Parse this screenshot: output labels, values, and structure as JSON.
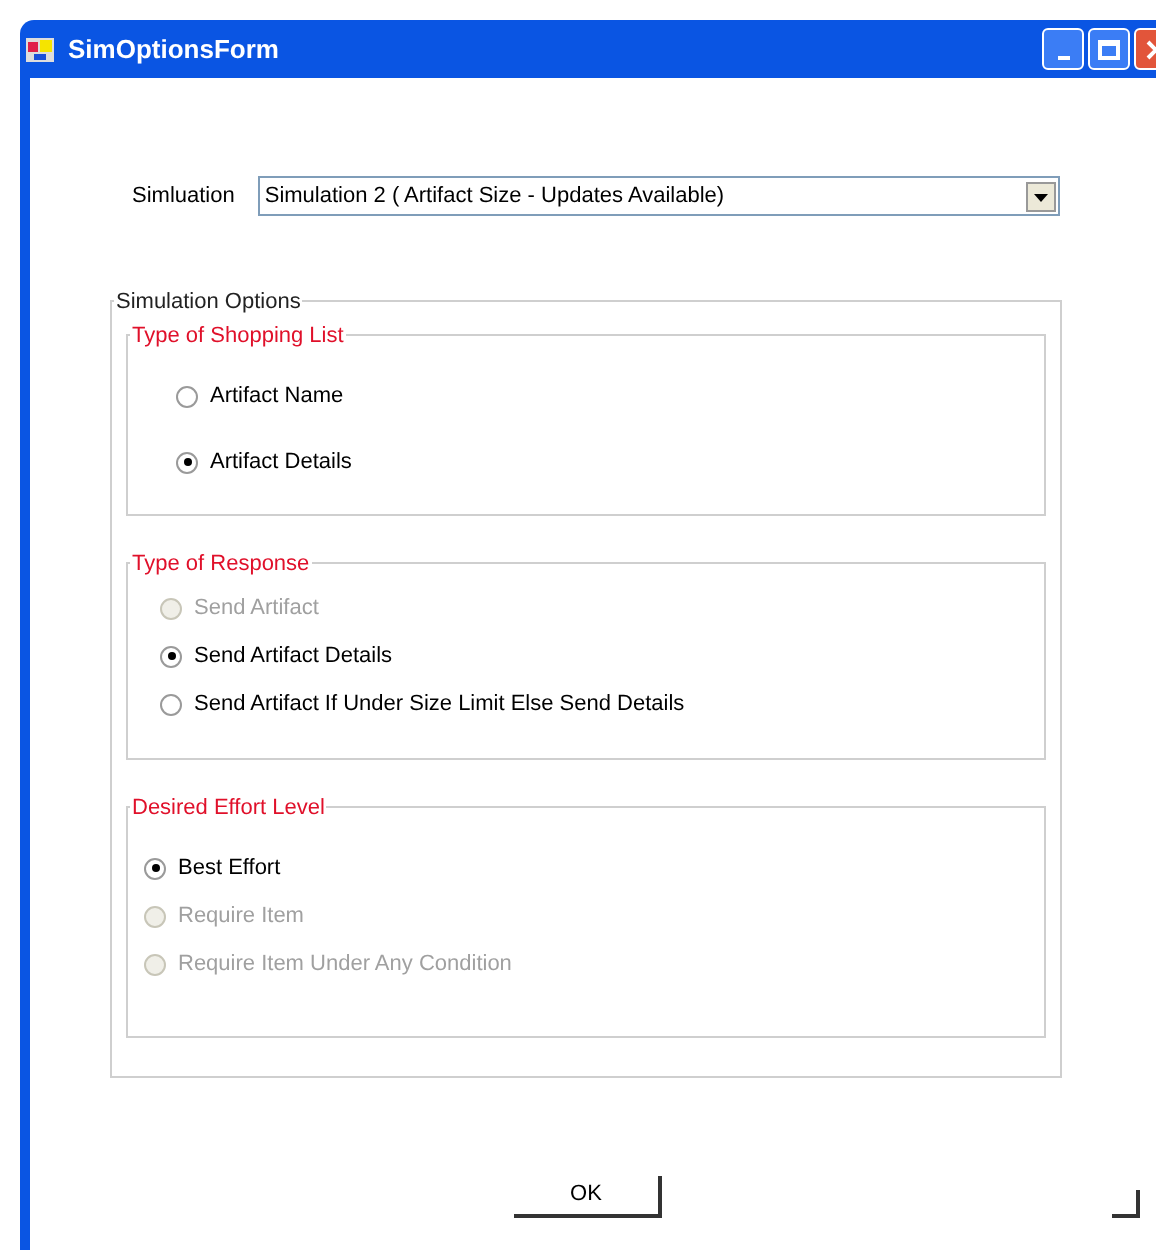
{
  "window": {
    "title": "SimOptionsForm"
  },
  "simulation": {
    "label": "Simluation",
    "value": "Simulation 2 ( Artifact Size - Updates Available)"
  },
  "options_group": {
    "title": "Simulation Options",
    "groups": [
      {
        "title": "Type of Shopping List",
        "spacious": true,
        "options": [
          {
            "label": "Artifact Name",
            "selected": false,
            "disabled": false
          },
          {
            "label": "Artifact Details",
            "selected": true,
            "disabled": false
          }
        ]
      },
      {
        "title": "Type of Response",
        "spacious": false,
        "options": [
          {
            "label": "Send Artifact",
            "selected": false,
            "disabled": true
          },
          {
            "label": "Send Artifact Details",
            "selected": true,
            "disabled": false
          },
          {
            "label": "Send Artifact If Under Size Limit Else Send Details",
            "selected": false,
            "disabled": false
          }
        ]
      },
      {
        "title": "Desired Effort Level",
        "spacious": false,
        "options": [
          {
            "label": "Best Effort",
            "selected": true,
            "disabled": false
          },
          {
            "label": "Require Item",
            "selected": false,
            "disabled": true
          },
          {
            "label": "Require Item Under Any Condition",
            "selected": false,
            "disabled": true
          }
        ]
      }
    ]
  },
  "ok_button": {
    "label": "OK"
  }
}
